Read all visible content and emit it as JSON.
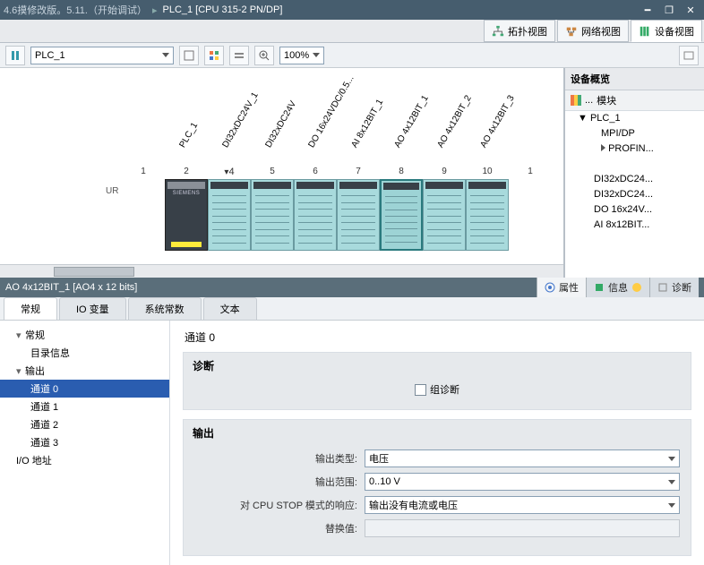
{
  "title": {
    "project": "4.6摸修改版。5.11.（开始调试）",
    "device": "PLC_1 [CPU 315-2 PN/DP]"
  },
  "viewTabs": {
    "topology": "拓扑视图",
    "network": "网络视图",
    "device": "设备视图"
  },
  "toolbar": {
    "device": "PLC_1",
    "zoom": "100%"
  },
  "rack": {
    "label": "UR",
    "slots": [
      {
        "num": "1",
        "name": ""
      },
      {
        "num": "2",
        "name": "PLC_1"
      },
      {
        "num": "4",
        "name": "DI32xDC24V_1"
      },
      {
        "num": "5",
        "name": "DI32xDC24V"
      },
      {
        "num": "6",
        "name": "DO 16x24VDC/0.5..."
      },
      {
        "num": "7",
        "name": "AI 8x12BIT_1"
      },
      {
        "num": "8",
        "name": "AO 4x12BIT_1"
      },
      {
        "num": "9",
        "name": "AO 4x12BIT_2"
      },
      {
        "num": "10",
        "name": "AO 4x12BIT_3"
      },
      {
        "num": "1",
        "name": ""
      }
    ]
  },
  "overview": {
    "title": "设备概览",
    "colModule": "模块",
    "items": [
      {
        "label": "PLC_1",
        "lvl": 1,
        "exp": "▼"
      },
      {
        "label": "MPI/DP",
        "lvl": 3
      },
      {
        "label": "PROFIN...",
        "lvl": 3,
        "exp": "▸"
      },
      {
        "label": "",
        "lvl": 3
      },
      {
        "label": "DI32xDC24...",
        "lvl": 2
      },
      {
        "label": "DI32xDC24...",
        "lvl": 2
      },
      {
        "label": "DO 16x24V...",
        "lvl": 2
      },
      {
        "label": "AI 8x12BIT...",
        "lvl": 2
      }
    ]
  },
  "detail": {
    "title": "AO 4x12BIT_1 [AO4 x 12 bits]",
    "tabs": {
      "props": "属性",
      "info": "信息",
      "diag": "诊断"
    },
    "subtabs": {
      "general": "常规",
      "iovar": "IO 变量",
      "sysconst": "系统常数",
      "text": "文本"
    },
    "nav": {
      "general": "常规",
      "catalog": "目录信息",
      "outputs": "输出",
      "ch0": "通道 0",
      "ch1": "通道 1",
      "ch2": "通道 2",
      "ch3": "通道 3",
      "ioaddr": "I/O 地址"
    },
    "form": {
      "heading": "通道 0",
      "diagGroup": "诊断",
      "groupDiag": "组诊断",
      "outGroup": "输出",
      "outputType": "输出类型:",
      "outputTypeVal": "电压",
      "outputRange": "输出范围:",
      "outputRangeVal": "0..10 V",
      "cpuStop": "对 CPU STOP 模式的响应:",
      "cpuStopVal": "输出没有电流或电压",
      "substitute": "替换值:"
    }
  }
}
